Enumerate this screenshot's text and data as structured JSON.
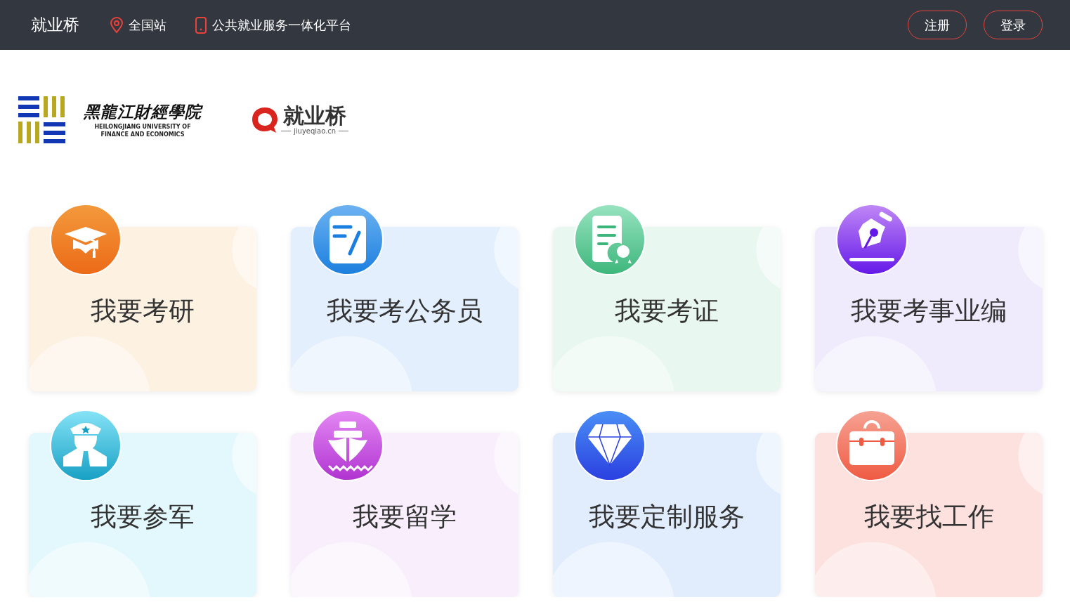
{
  "header": {
    "brand": "就业桥",
    "links": [
      {
        "kind": "location",
        "label": "全国站"
      },
      {
        "kind": "phone",
        "label": "公共就业服务一体化平台"
      }
    ],
    "buttons": [
      "注册",
      "登录"
    ]
  },
  "logos": {
    "university": {
      "name": "黑龍江財經學院",
      "english": [
        "HEILONGJIANG UNIVERSITY OF",
        "FINANCE AND ECONOMICS"
      ]
    },
    "jiuyeqiao": {
      "name": "就业桥",
      "domain": "jiuyeqiao.cn"
    }
  },
  "services": [
    {
      "kind": "graduate",
      "label": "我要考研",
      "color": "#fdf1e2"
    },
    {
      "kind": "civil",
      "label": "我要考公务员",
      "color": "#e3effd"
    },
    {
      "kind": "certificate",
      "label": "我要考证",
      "color": "#e9f7f1"
    },
    {
      "kind": "institution",
      "label": "我要考事业编",
      "color": "#efebfc"
    },
    {
      "kind": "military",
      "label": "我要参军",
      "color": "#e3f8fd"
    },
    {
      "kind": "abroad",
      "label": "我要留学",
      "color": "#f9effc"
    },
    {
      "kind": "custom",
      "label": "我要定制服务",
      "color": "#e1edfd"
    },
    {
      "kind": "job",
      "label": "我要找工作",
      "color": "#fce1de"
    }
  ]
}
